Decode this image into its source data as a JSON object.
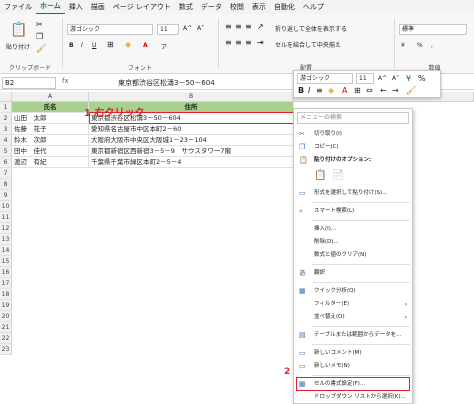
{
  "menu": [
    "ファイル",
    "ホーム",
    "挿入",
    "描画",
    "ページ レイアウト",
    "数式",
    "データ",
    "校閲",
    "表示",
    "自動化",
    "ヘルプ"
  ],
  "ribbon": {
    "clipboard": {
      "paste": "貼り付け",
      "label": "クリップボード"
    },
    "font": {
      "name": "游ゴシック",
      "size": "11",
      "bold": "B",
      "italic": "I",
      "underline": "U",
      "grow": "A^",
      "shrink": "A˅",
      "color_letter": "A",
      "phonetic": "ア",
      "label": "フォント"
    },
    "align": {
      "wrap": "折り返して全体を表示する",
      "merge": "セルを結合して中央揃え",
      "label": "配置"
    },
    "number": {
      "format": "標準",
      "currency": "¥",
      "percent": "%",
      "comma": ",",
      "label": "数値"
    }
  },
  "formula": {
    "namebox": "B2",
    "fx": "fx",
    "value": "東京都渋谷区松濤3－50－604"
  },
  "columns": [
    "A",
    "B",
    "C"
  ],
  "rows": [
    "1",
    "2",
    "3",
    "4",
    "5",
    "6",
    "7",
    "8",
    "9",
    "10",
    "11",
    "12",
    "13",
    "14",
    "15",
    "16",
    "17",
    "18",
    "19",
    "20",
    "21",
    "22",
    "23"
  ],
  "table": {
    "headers": [
      "氏名",
      "住所"
    ],
    "data": [
      [
        "山田　太郎",
        "東京都渋谷区松濤3－50－604"
      ],
      [
        "佐藤　花子",
        "愛知県名古屋市中区本町2－60"
      ],
      [
        "鈴木　次郎",
        "大阪府大阪市中央区大阪城1－23－104"
      ],
      [
        "田中　佳代",
        "東京都新宿区西新宿3－5－9　サウスタワー7階"
      ],
      [
        "渡辺　有紀",
        "千葉県千葉市緑区本町2－5－4"
      ]
    ]
  },
  "minitoolbar": {
    "font": "游ゴシック",
    "size": "11"
  },
  "context_menu": {
    "search_placeholder": "メニューの検索",
    "items": {
      "cut": "切り取り(I)",
      "copy": "コピー(C)",
      "paste_options": "貼り付けのオプション:",
      "paste_special": "形式を選択して貼り付け(S)...",
      "smart_lookup": "スマート検索(L)",
      "insert": "挿入(I)...",
      "delete": "削除(D)...",
      "clear": "数式と値のクリア(N)",
      "translate": "翻訳",
      "quick_analysis": "クイック分析(Q)",
      "filter": "フィルター(E)",
      "sort": "並べ替え(O)",
      "table_data": "テーブルまたは範囲からデータを...",
      "new_comment": "新しいコメント(M)",
      "new_note": "新しいメモ(N)",
      "format_cells": "セルの書式設定(F)...",
      "dropdown": "ドロップダウン リストから選択(K)..."
    }
  },
  "annotations": {
    "step1": "1 右クリック",
    "step2": "2"
  }
}
